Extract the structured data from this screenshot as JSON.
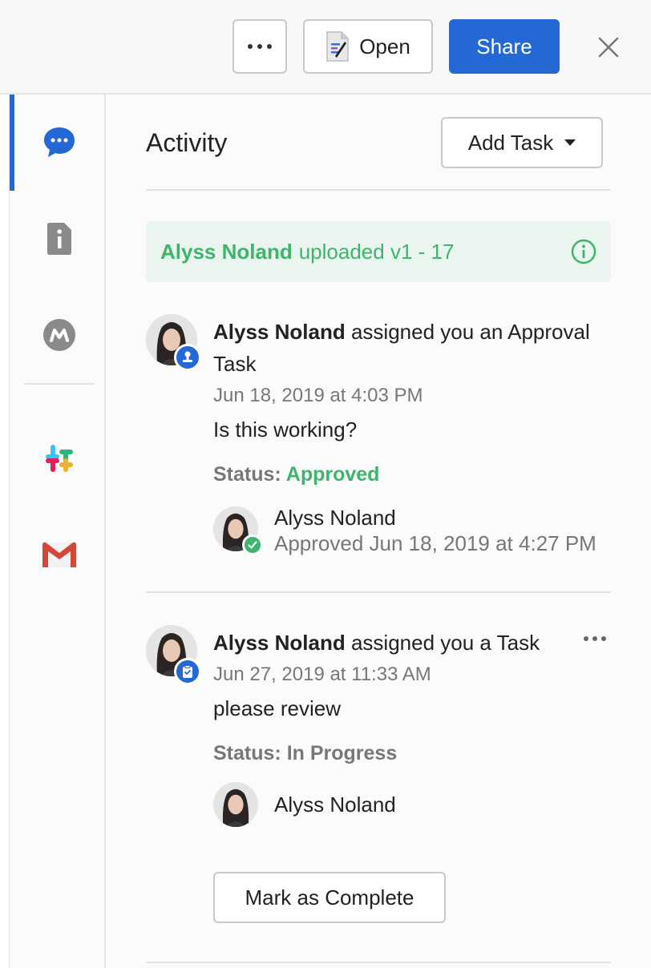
{
  "header": {
    "more_label": "More options",
    "open_label": "Open",
    "share_label": "Share"
  },
  "rail": {
    "items": [
      {
        "icon": "activity-comment-icon",
        "active": true
      },
      {
        "icon": "details-info-icon",
        "active": false
      },
      {
        "icon": "metadata-m-icon",
        "active": false
      },
      {
        "icon": "slack-icon",
        "active": false
      },
      {
        "icon": "gmail-icon",
        "active": false
      }
    ]
  },
  "activity": {
    "title": "Activity",
    "add_task_label": "Add Task",
    "upload_notice": {
      "user": "Alyss Noland",
      "text": "uploaded v1 - 17"
    },
    "feed": [
      {
        "user": "Alyss Noland",
        "action_line1": "assigned you an Approval",
        "action_line2": "Task",
        "timestamp": "Jun 18, 2019 at 4:03 PM",
        "message": "Is this working?",
        "status_label": "Status:",
        "status_value": "Approved",
        "assignee": "Alyss Noland",
        "assignee_status": "Approved Jun 18, 2019 at 4:27 PM"
      },
      {
        "user": "Alyss Noland",
        "action_line1": "assigned you a Task",
        "timestamp": "Jun 27, 2019 at 11:33 AM",
        "message": "please review",
        "status_label": "Status:",
        "status_value": "In Progress",
        "assignee": "Alyss Noland",
        "complete_label": "Mark as Complete"
      }
    ]
  },
  "colors": {
    "accent": "#2468d6",
    "success": "#3fb46d",
    "banner_bg": "#e9f5ee"
  }
}
